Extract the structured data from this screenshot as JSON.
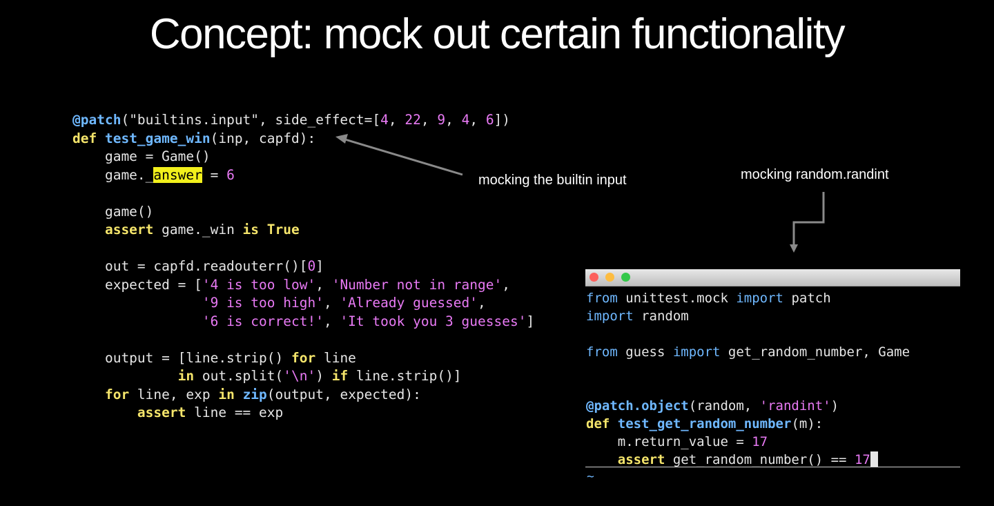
{
  "title": "Concept: mock out certain functionality",
  "annotations": {
    "mock_input": "mocking the builtin input",
    "mock_randint": "mocking random.randint"
  },
  "left_code": [
    [
      [
        "dec",
        "@patch"
      ],
      [
        "txt",
        "(\"builtins.input\", side_effect=["
      ],
      [
        "num",
        "4"
      ],
      [
        "txt",
        ", "
      ],
      [
        "num",
        "22"
      ],
      [
        "txt",
        ", "
      ],
      [
        "num",
        "9"
      ],
      [
        "txt",
        ", "
      ],
      [
        "num",
        "4"
      ],
      [
        "txt",
        ", "
      ],
      [
        "num",
        "6"
      ],
      [
        "txt",
        "])"
      ]
    ],
    [
      [
        "kw",
        "def "
      ],
      [
        "fn",
        "test_game_win"
      ],
      [
        "txt",
        "(inp, capfd):"
      ]
    ],
    [
      [
        "txt",
        "    game = Game()"
      ]
    ],
    [
      [
        "txt",
        "    game._"
      ],
      [
        "hl",
        "answer"
      ],
      [
        "txt",
        " = "
      ],
      [
        "num",
        "6"
      ]
    ],
    [
      [
        "txt",
        ""
      ]
    ],
    [
      [
        "txt",
        "    game()"
      ]
    ],
    [
      [
        "kw",
        "    assert"
      ],
      [
        "txt",
        " game._win "
      ],
      [
        "kw",
        "is True"
      ]
    ],
    [
      [
        "txt",
        ""
      ]
    ],
    [
      [
        "txt",
        "    out = capfd.readouterr()["
      ],
      [
        "num",
        "0"
      ],
      [
        "txt",
        "]"
      ]
    ],
    [
      [
        "txt",
        "    expected = ["
      ],
      [
        "str",
        "'4 is too low'"
      ],
      [
        "txt",
        ", "
      ],
      [
        "str",
        "'Number not in range'"
      ],
      [
        "txt",
        ","
      ]
    ],
    [
      [
        "txt",
        "                "
      ],
      [
        "str",
        "'9 is too high'"
      ],
      [
        "txt",
        ", "
      ],
      [
        "str",
        "'Already guessed'"
      ],
      [
        "txt",
        ","
      ]
    ],
    [
      [
        "txt",
        "                "
      ],
      [
        "str",
        "'6 is correct!'"
      ],
      [
        "txt",
        ", "
      ],
      [
        "str",
        "'It took you 3 guesses'"
      ],
      [
        "txt",
        "]"
      ]
    ],
    [
      [
        "txt",
        ""
      ]
    ],
    [
      [
        "txt",
        "    output = [line.strip() "
      ],
      [
        "kw",
        "for"
      ],
      [
        "txt",
        " line"
      ]
    ],
    [
      [
        "kw",
        "             in"
      ],
      [
        "txt",
        " out.split("
      ],
      [
        "str",
        "'\\n'"
      ],
      [
        "txt",
        ") "
      ],
      [
        "kw",
        "if"
      ],
      [
        "txt",
        " line.strip()]"
      ]
    ],
    [
      [
        "kw",
        "    for"
      ],
      [
        "txt",
        " line, exp "
      ],
      [
        "kw",
        "in"
      ],
      [
        "txt",
        " "
      ],
      [
        "fn",
        "zip"
      ],
      [
        "txt",
        "(output, expected):"
      ]
    ],
    [
      [
        "kw",
        "        assert"
      ],
      [
        "txt",
        " line == exp"
      ]
    ]
  ],
  "terminal": {
    "colors": {
      "close": "#fc605c",
      "minimize": "#fdbc40",
      "zoom": "#34c84a"
    },
    "lines": [
      [
        [
          "blue",
          "from"
        ],
        [
          "txt",
          " unittest.mock "
        ],
        [
          "blue",
          "import"
        ],
        [
          "txt",
          " patch"
        ]
      ],
      [
        [
          "blue",
          "import"
        ],
        [
          "txt",
          " random"
        ]
      ],
      [
        [
          "txt",
          ""
        ]
      ],
      [
        [
          "blue",
          "from"
        ],
        [
          "txt",
          " guess "
        ],
        [
          "blue",
          "import"
        ],
        [
          "txt",
          " get_random_number, Game"
        ]
      ],
      [
        [
          "txt",
          ""
        ]
      ],
      [
        [
          "txt",
          ""
        ]
      ],
      [
        [
          "dec",
          "@patch.object"
        ],
        [
          "txt",
          "(random, "
        ],
        [
          "str",
          "'randint'"
        ],
        [
          "txt",
          ")"
        ]
      ],
      [
        [
          "kw",
          "def "
        ],
        [
          "fn",
          "test_get_random_number"
        ],
        [
          "txt",
          "(m):"
        ]
      ],
      [
        [
          "txt",
          "    m.return_value = "
        ],
        [
          "num",
          "17"
        ]
      ],
      [
        [
          "kw",
          "    assert"
        ],
        [
          "txt",
          " get_random_number() == "
        ],
        [
          "num",
          "17"
        ]
      ]
    ],
    "tilde": "~"
  }
}
